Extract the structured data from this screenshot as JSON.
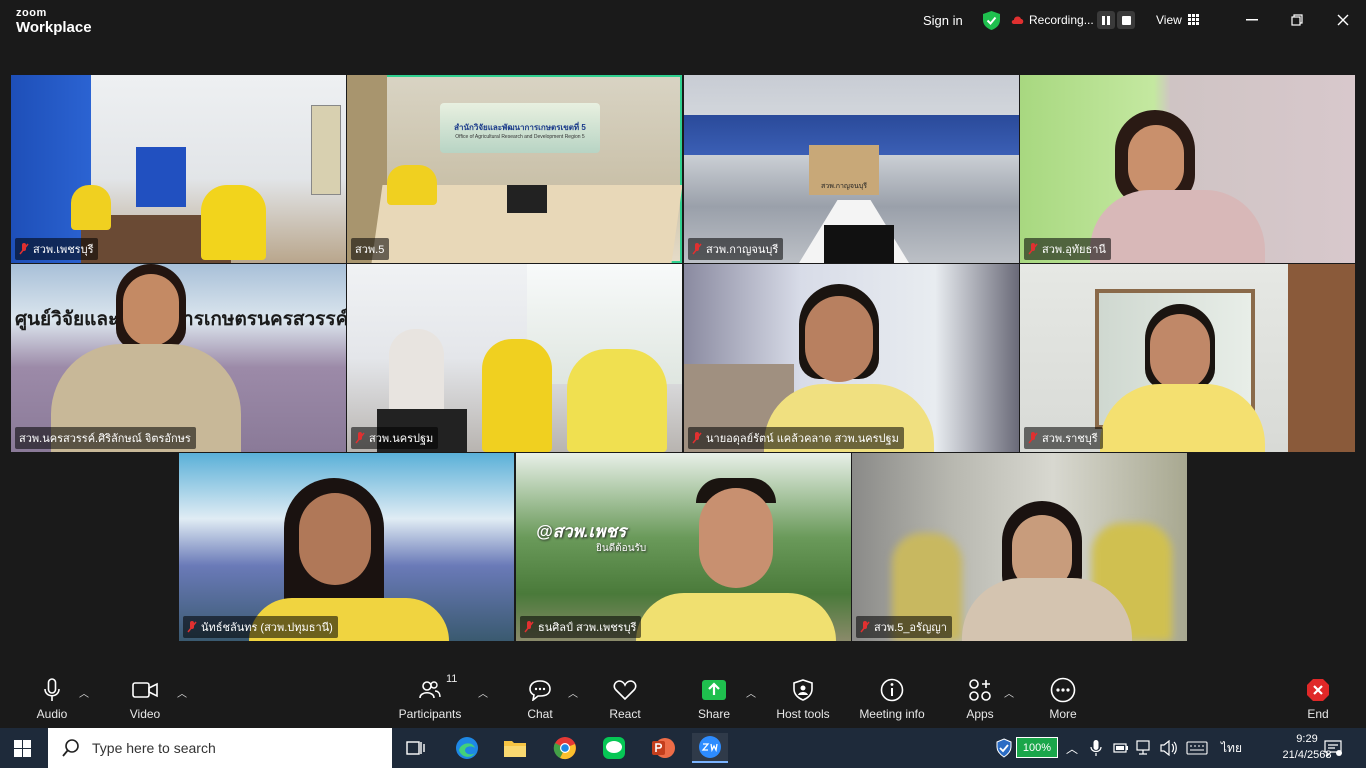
{
  "app": {
    "brand_top": "zoom",
    "brand_bottom": "Workplace"
  },
  "header": {
    "sign_in": "Sign in",
    "recording": "Recording...",
    "view": "View"
  },
  "tiles": [
    {
      "name": "สวพ.เพชรบุรี",
      "active": false
    },
    {
      "name": "สวพ.5",
      "active": true
    },
    {
      "name": "สวพ.กาญจนบุรี",
      "active": false
    },
    {
      "name": "สวพ.อุทัยธานี",
      "active": false
    },
    {
      "name": "สวพ.นครสวรรค์.ศิริลักษณ์ จิตรอักษร",
      "active": false
    },
    {
      "name": "สวพ.นครปฐม",
      "active": false
    },
    {
      "name": "นายอดุลย์รัตน์ แคล้วคลาด สวพ.นครปฐม",
      "active": false
    },
    {
      "name": "สวพ.ราชบุรี",
      "active": false
    },
    {
      "name": "นัทธ์ชลันทร (สวพ.ปทุมธานี)",
      "active": false
    },
    {
      "name": "ธนศิลป์ สวพ.เพชรบุรี",
      "active": false
    },
    {
      "name": "สวพ.5_อรัญญา",
      "active": false
    }
  ],
  "scene_text": {
    "banner": "สำนักวิจัยและพัฒนาการเกษตรเขตที่ 5",
    "banner_en": "Office of Agricultural Research and Development Region 5",
    "building_sign": "สวพ.กาญจนบุรี",
    "large_banner": "ศูนย์วิจัยและพัฒนาการเกษตรนครสวรรค์",
    "garden_sign": "@สวพ.เพชร",
    "garden_sign2": "ยินดีต้อนรับ"
  },
  "toolbar": {
    "audio": "Audio",
    "video": "Video",
    "participants": "Participants",
    "participants_count": "11",
    "chat": "Chat",
    "react": "React",
    "share": "Share",
    "host_tools": "Host tools",
    "meeting_info": "Meeting info",
    "apps": "Apps",
    "more": "More",
    "end": "End"
  },
  "taskbar": {
    "search_placeholder": "Type here to search",
    "battery": "100%",
    "lang": "ไทย",
    "time": "9:29",
    "date": "21/4/2568"
  },
  "colors": {
    "active_border": "#30d090",
    "share_green": "#1fbf4e",
    "end_red": "#e02828",
    "mute_red": "#e03030",
    "shield_green": "#1fbf4e"
  }
}
